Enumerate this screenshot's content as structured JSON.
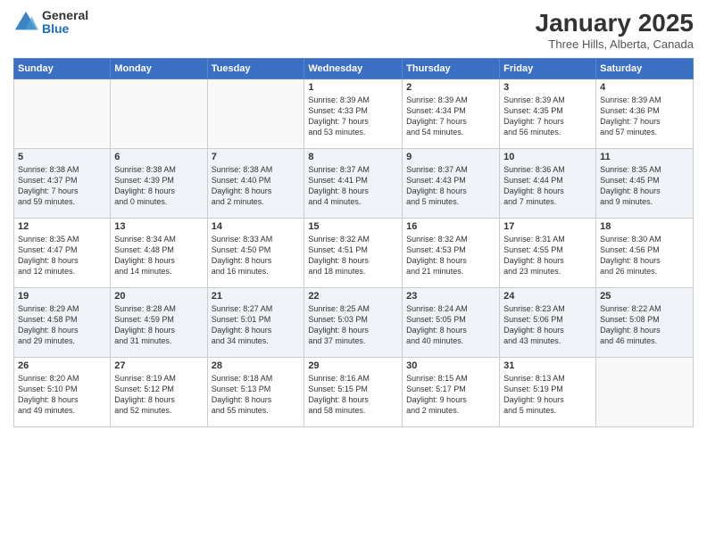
{
  "logo": {
    "general": "General",
    "blue": "Blue"
  },
  "header": {
    "month_year": "January 2025",
    "location": "Three Hills, Alberta, Canada"
  },
  "days_of_week": [
    "Sunday",
    "Monday",
    "Tuesday",
    "Wednesday",
    "Thursday",
    "Friday",
    "Saturday"
  ],
  "weeks": [
    [
      {
        "day": "",
        "info": ""
      },
      {
        "day": "",
        "info": ""
      },
      {
        "day": "",
        "info": ""
      },
      {
        "day": "1",
        "info": "Sunrise: 8:39 AM\nSunset: 4:33 PM\nDaylight: 7 hours\nand 53 minutes."
      },
      {
        "day": "2",
        "info": "Sunrise: 8:39 AM\nSunset: 4:34 PM\nDaylight: 7 hours\nand 54 minutes."
      },
      {
        "day": "3",
        "info": "Sunrise: 8:39 AM\nSunset: 4:35 PM\nDaylight: 7 hours\nand 56 minutes."
      },
      {
        "day": "4",
        "info": "Sunrise: 8:39 AM\nSunset: 4:36 PM\nDaylight: 7 hours\nand 57 minutes."
      }
    ],
    [
      {
        "day": "5",
        "info": "Sunrise: 8:38 AM\nSunset: 4:37 PM\nDaylight: 7 hours\nand 59 minutes."
      },
      {
        "day": "6",
        "info": "Sunrise: 8:38 AM\nSunset: 4:39 PM\nDaylight: 8 hours\nand 0 minutes."
      },
      {
        "day": "7",
        "info": "Sunrise: 8:38 AM\nSunset: 4:40 PM\nDaylight: 8 hours\nand 2 minutes."
      },
      {
        "day": "8",
        "info": "Sunrise: 8:37 AM\nSunset: 4:41 PM\nDaylight: 8 hours\nand 4 minutes."
      },
      {
        "day": "9",
        "info": "Sunrise: 8:37 AM\nSunset: 4:43 PM\nDaylight: 8 hours\nand 5 minutes."
      },
      {
        "day": "10",
        "info": "Sunrise: 8:36 AM\nSunset: 4:44 PM\nDaylight: 8 hours\nand 7 minutes."
      },
      {
        "day": "11",
        "info": "Sunrise: 8:35 AM\nSunset: 4:45 PM\nDaylight: 8 hours\nand 9 minutes."
      }
    ],
    [
      {
        "day": "12",
        "info": "Sunrise: 8:35 AM\nSunset: 4:47 PM\nDaylight: 8 hours\nand 12 minutes."
      },
      {
        "day": "13",
        "info": "Sunrise: 8:34 AM\nSunset: 4:48 PM\nDaylight: 8 hours\nand 14 minutes."
      },
      {
        "day": "14",
        "info": "Sunrise: 8:33 AM\nSunset: 4:50 PM\nDaylight: 8 hours\nand 16 minutes."
      },
      {
        "day": "15",
        "info": "Sunrise: 8:32 AM\nSunset: 4:51 PM\nDaylight: 8 hours\nand 18 minutes."
      },
      {
        "day": "16",
        "info": "Sunrise: 8:32 AM\nSunset: 4:53 PM\nDaylight: 8 hours\nand 21 minutes."
      },
      {
        "day": "17",
        "info": "Sunrise: 8:31 AM\nSunset: 4:55 PM\nDaylight: 8 hours\nand 23 minutes."
      },
      {
        "day": "18",
        "info": "Sunrise: 8:30 AM\nSunset: 4:56 PM\nDaylight: 8 hours\nand 26 minutes."
      }
    ],
    [
      {
        "day": "19",
        "info": "Sunrise: 8:29 AM\nSunset: 4:58 PM\nDaylight: 8 hours\nand 29 minutes."
      },
      {
        "day": "20",
        "info": "Sunrise: 8:28 AM\nSunset: 4:59 PM\nDaylight: 8 hours\nand 31 minutes."
      },
      {
        "day": "21",
        "info": "Sunrise: 8:27 AM\nSunset: 5:01 PM\nDaylight: 8 hours\nand 34 minutes."
      },
      {
        "day": "22",
        "info": "Sunrise: 8:25 AM\nSunset: 5:03 PM\nDaylight: 8 hours\nand 37 minutes."
      },
      {
        "day": "23",
        "info": "Sunrise: 8:24 AM\nSunset: 5:05 PM\nDaylight: 8 hours\nand 40 minutes."
      },
      {
        "day": "24",
        "info": "Sunrise: 8:23 AM\nSunset: 5:06 PM\nDaylight: 8 hours\nand 43 minutes."
      },
      {
        "day": "25",
        "info": "Sunrise: 8:22 AM\nSunset: 5:08 PM\nDaylight: 8 hours\nand 46 minutes."
      }
    ],
    [
      {
        "day": "26",
        "info": "Sunrise: 8:20 AM\nSunset: 5:10 PM\nDaylight: 8 hours\nand 49 minutes."
      },
      {
        "day": "27",
        "info": "Sunrise: 8:19 AM\nSunset: 5:12 PM\nDaylight: 8 hours\nand 52 minutes."
      },
      {
        "day": "28",
        "info": "Sunrise: 8:18 AM\nSunset: 5:13 PM\nDaylight: 8 hours\nand 55 minutes."
      },
      {
        "day": "29",
        "info": "Sunrise: 8:16 AM\nSunset: 5:15 PM\nDaylight: 8 hours\nand 58 minutes."
      },
      {
        "day": "30",
        "info": "Sunrise: 8:15 AM\nSunset: 5:17 PM\nDaylight: 9 hours\nand 2 minutes."
      },
      {
        "day": "31",
        "info": "Sunrise: 8:13 AM\nSunset: 5:19 PM\nDaylight: 9 hours\nand 5 minutes."
      },
      {
        "day": "",
        "info": ""
      }
    ]
  ]
}
